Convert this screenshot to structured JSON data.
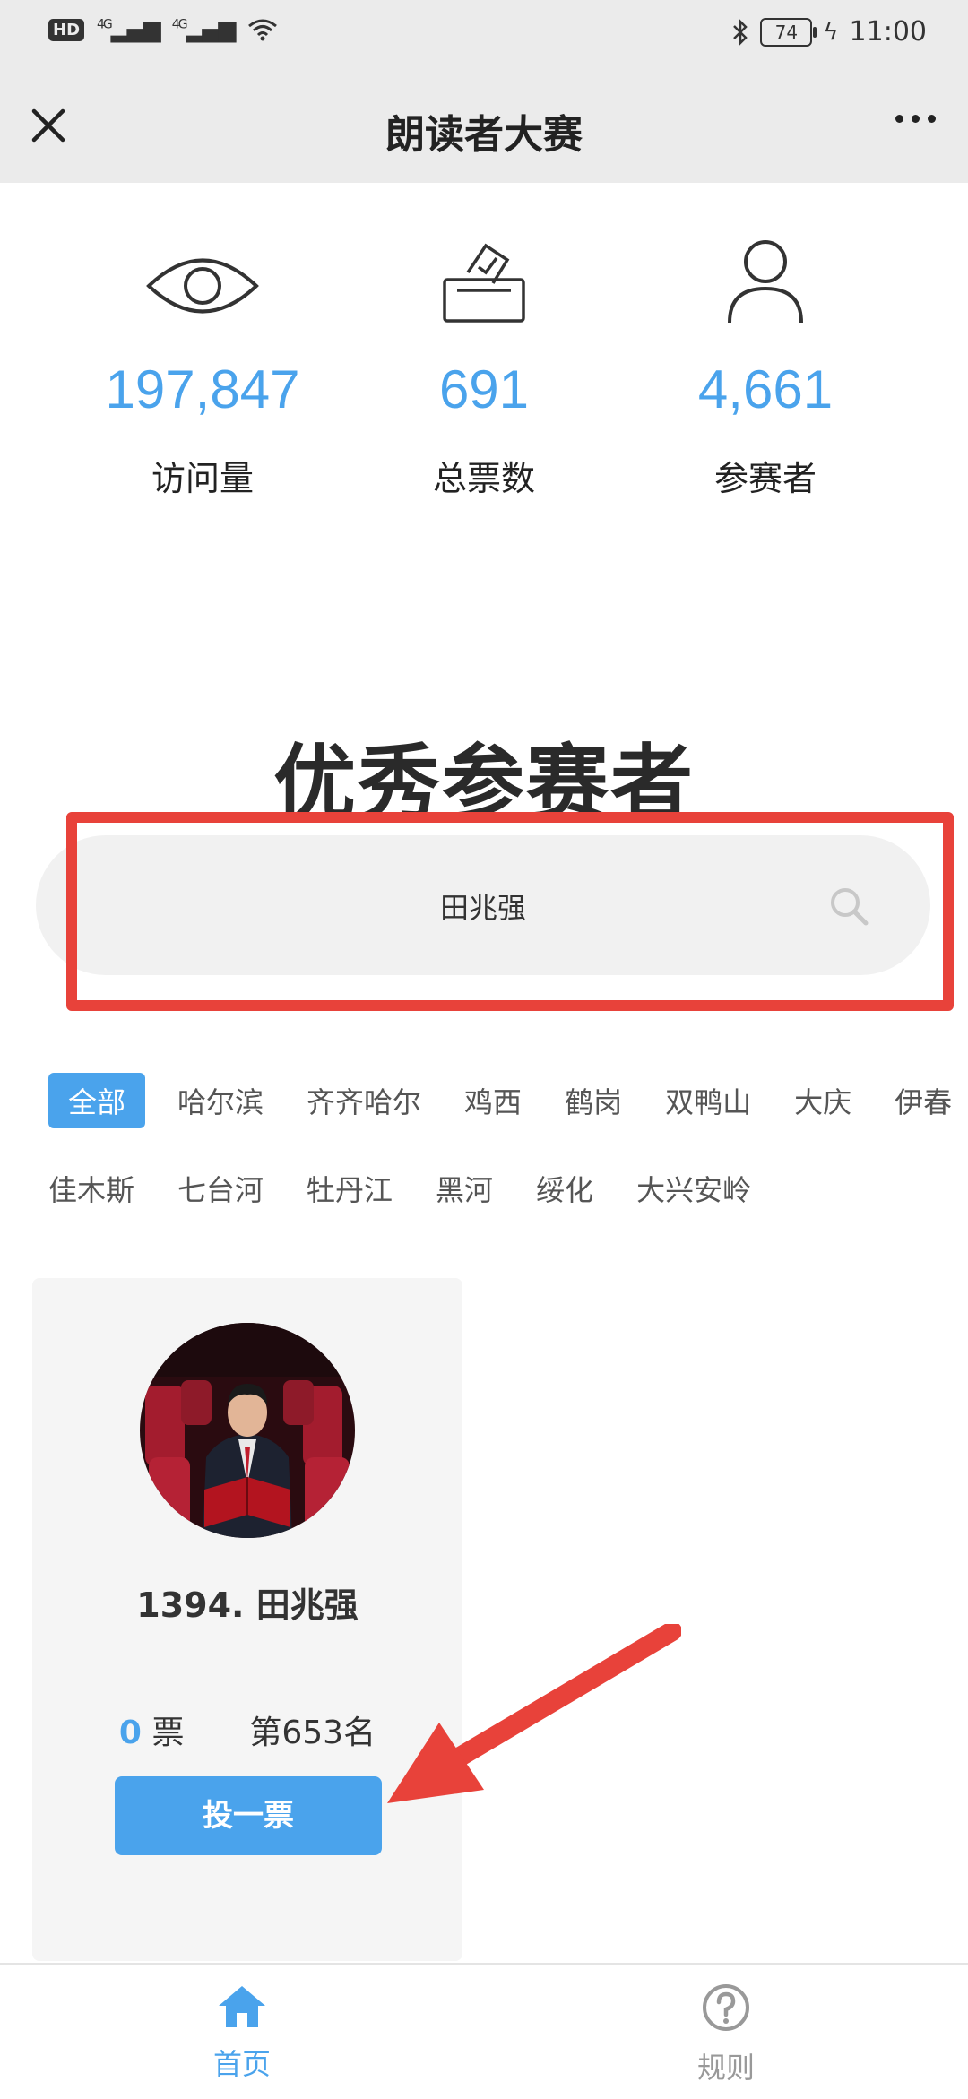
{
  "status_bar": {
    "hd_label": "HD",
    "sim_1": "4G",
    "sim_2": "4G",
    "battery": "74",
    "time": "11:00"
  },
  "navbar": {
    "title": "朗读者大赛"
  },
  "stats": [
    {
      "value": "197,847",
      "label": "访问量",
      "icon": "eye-icon"
    },
    {
      "value": "691",
      "label": "总票数",
      "icon": "ballot-box-icon"
    },
    {
      "value": "4,661",
      "label": "参赛者",
      "icon": "person-icon"
    }
  ],
  "section_title": "优秀参赛者",
  "search": {
    "value": "田兆强"
  },
  "tags": {
    "row1": [
      "全部",
      "哈尔滨",
      "齐齐哈尔",
      "鸡西",
      "鹤岗",
      "双鸭山",
      "大庆",
      "伊春"
    ],
    "row2": [
      "佳木斯",
      "七台河",
      "牡丹江",
      "黑河",
      "绥化",
      "大兴安岭"
    ],
    "active": "全部"
  },
  "card": {
    "name": "1394. 田兆强",
    "votes": "0",
    "votes_unit": "票",
    "rank": "第653名",
    "vote_button": "投一票"
  },
  "tabbar": {
    "home_label": "首页",
    "rules_label": "规则"
  },
  "colors": {
    "accent": "#4aa3ec",
    "highlight": "#e8423a",
    "bar_bg": "#ebebeb"
  }
}
